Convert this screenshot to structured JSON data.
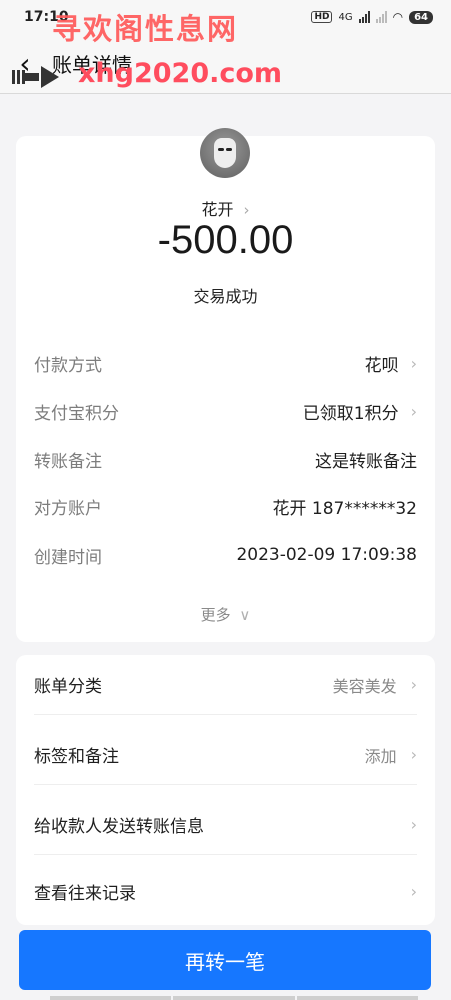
{
  "status_bar": {
    "time": "17:10",
    "hd": "HD",
    "network": "4G",
    "battery": "64"
  },
  "watermark": {
    "cn": "寻欢阁性息网",
    "en": "xhg2020.com"
  },
  "nav": {
    "title": "账单详情"
  },
  "summary": {
    "payee": "花开",
    "amount": "-500.00",
    "status": "交易成功"
  },
  "details": [
    {
      "key": "付款方式",
      "value": "花呗",
      "chevron": true
    },
    {
      "key": "支付宝积分",
      "value": "已领取1积分",
      "chevron": true
    },
    {
      "key": "转账备注",
      "value": "这是转账备注",
      "chevron": false
    },
    {
      "key": "对方账户",
      "value": "花开 187******32",
      "chevron": false
    },
    {
      "key": "创建时间",
      "value": "2023-02-09 17:09:38",
      "chevron": false
    }
  ],
  "more_label": "更多",
  "links": [
    {
      "key": "账单分类",
      "value": "美容美发"
    },
    {
      "key": "标签和备注",
      "value": "添加"
    },
    {
      "key": "给收款人发送转账信息",
      "value": ""
    },
    {
      "key": "查看往来记录",
      "value": ""
    }
  ],
  "primary_button": "再转一笔",
  "colors": {
    "accent": "#1677ff",
    "watermark": "#ff5a5a"
  }
}
